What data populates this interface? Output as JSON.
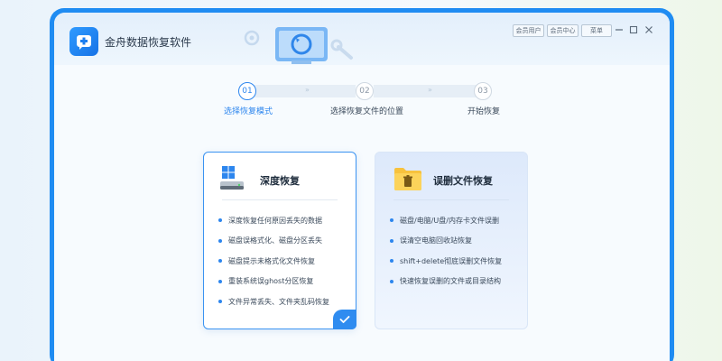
{
  "app": {
    "title": "金舟数据恢复软件"
  },
  "titlebar": {
    "buttons": {
      "member_user": "会员用户",
      "member_center": "会员中心",
      "menu": "菜单"
    }
  },
  "steps": [
    {
      "number": "01",
      "label": "选择恢复模式",
      "active": true
    },
    {
      "number": "02",
      "label": "选择恢复文件的位置",
      "active": false
    },
    {
      "number": "03",
      "label": "开始恢复",
      "active": false
    }
  ],
  "cards": [
    {
      "title": "深度恢复",
      "icon": "drive-windows-icon",
      "selected": true,
      "items": [
        "深度恢复任何原因丢失的数据",
        "磁盘误格式化、磁盘分区丢失",
        "磁盘提示未格式化文件恢复",
        "重装系统误ghost分区恢复",
        "文件异常丢失、文件夹乱码恢复"
      ]
    },
    {
      "title": "误删文件恢复",
      "icon": "folder-trash-icon",
      "selected": false,
      "items": [
        "磁盘/电脑/U盘/内存卡文件误删",
        "误清空电脑回收站恢复",
        "shift+delete彻底误删文件恢复",
        "快速恢复误删的文件或目录结构"
      ]
    }
  ],
  "colors": {
    "accent": "#1f8cf2",
    "text": "#1f2d3d",
    "active_step": "#2d86ee"
  }
}
